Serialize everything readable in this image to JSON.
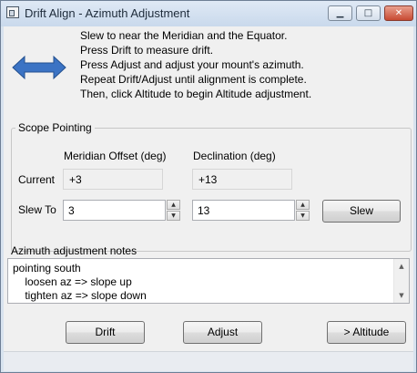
{
  "window": {
    "title": "Drift Align - Azimuth Adjustment",
    "min_glyph": "▁",
    "max_glyph": "□",
    "close_glyph": "✕"
  },
  "instructions": [
    "Slew to near the Meridian and the Equator.",
    "Press Drift to measure drift.",
    "Press Adjust and adjust your mount's azimuth.",
    "Repeat Drift/Adjust until alignment is complete.",
    "Then, click Altitude to begin Altitude adjustment."
  ],
  "icon": {
    "name": "double-arrow-icon",
    "color": "#3b73c4"
  },
  "scope_pointing": {
    "legend": "Scope Pointing",
    "col_meridian": "Meridian Offset (deg)",
    "col_declination": "Declination (deg)",
    "row_current": "Current",
    "row_slew_to": "Slew To",
    "current_meridian": "+3",
    "current_declination": "+13",
    "slew_meridian": "3",
    "slew_declination": "13",
    "spin_up": "▲",
    "spin_down": "▼",
    "slew_button": "Slew"
  },
  "notes": {
    "label": "Azimuth adjustment notes",
    "text": "pointing south\n    loosen az => slope up\n    tighten az => slope down",
    "scroll_up": "▲",
    "scroll_down": "▼"
  },
  "buttons": {
    "drift": "Drift",
    "adjust": "Adjust",
    "altitude": "> Altitude"
  }
}
